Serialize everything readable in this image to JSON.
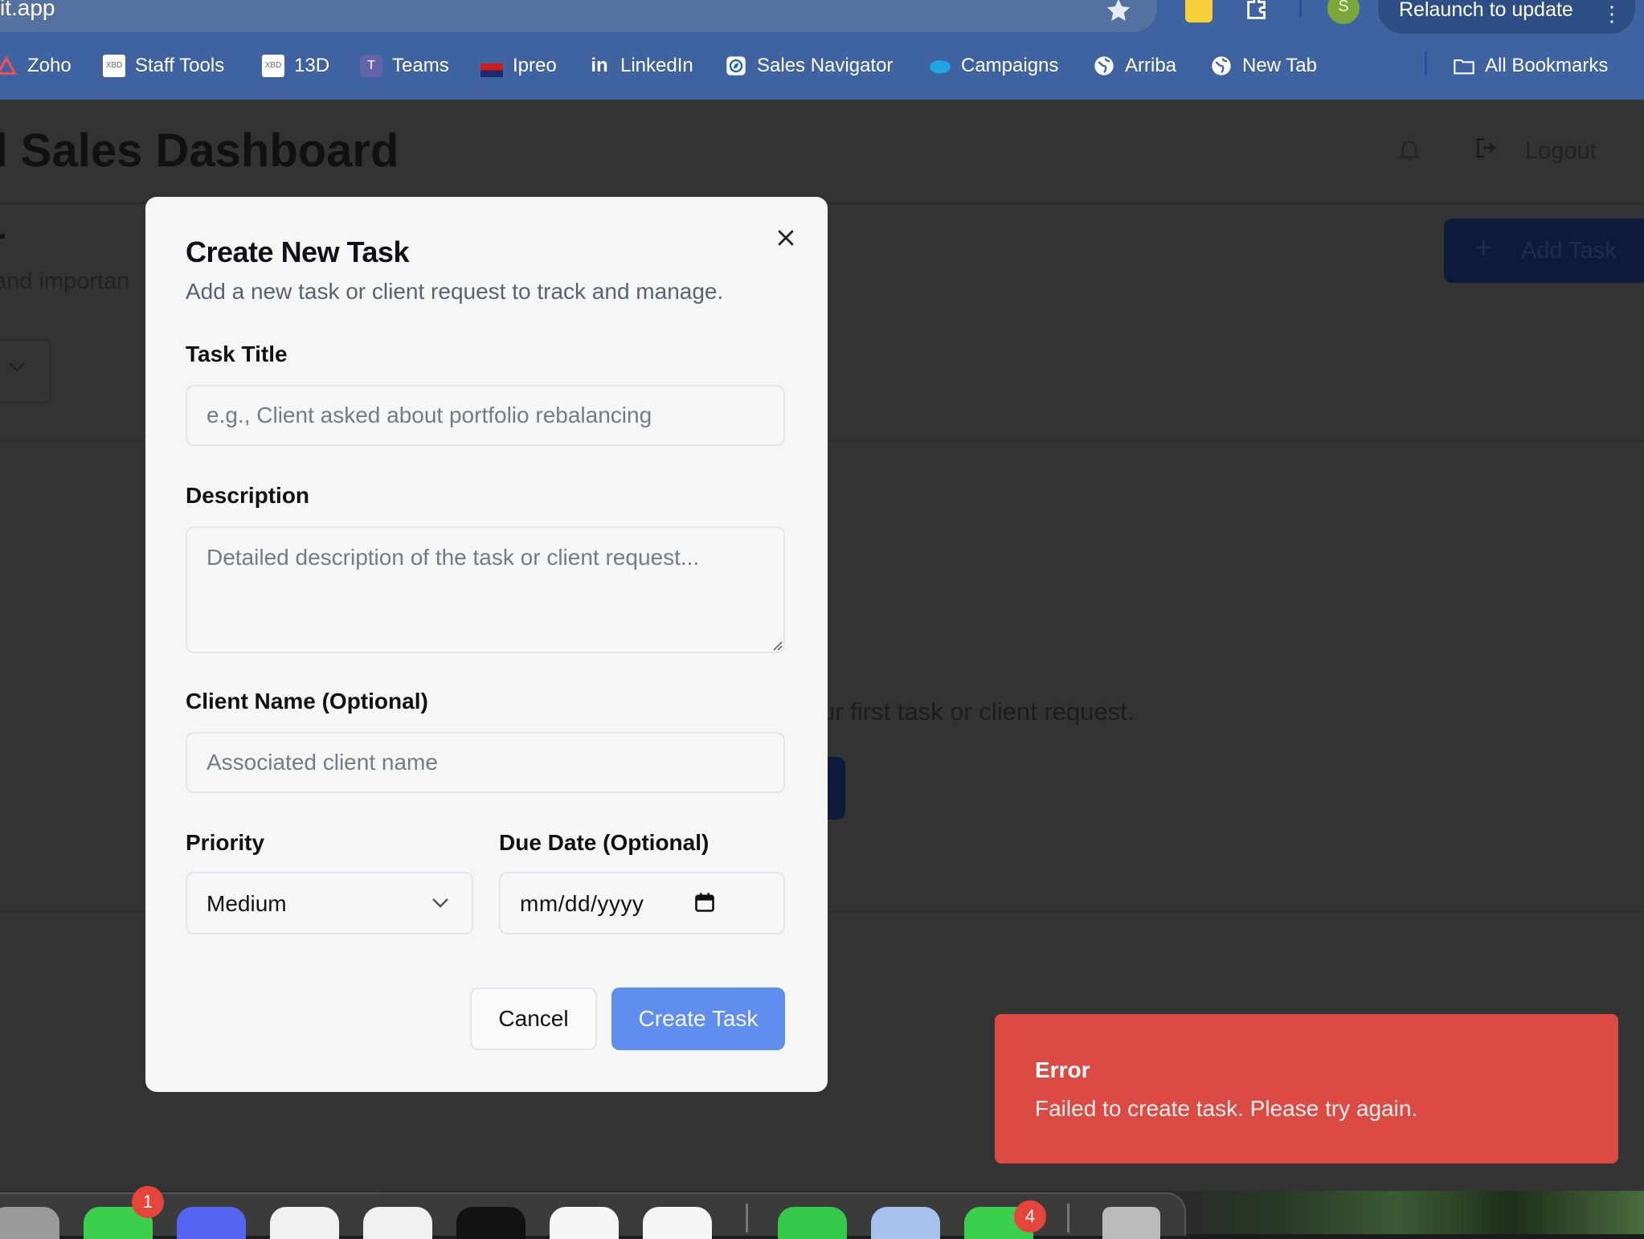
{
  "browser": {
    "url_fragment": "it.app",
    "relaunch_label": "Relaunch to update",
    "profile_initial": "S",
    "bookmarks": [
      {
        "label": "Zoho",
        "icon": "zoho-icon"
      },
      {
        "label": "Staff Tools",
        "icon": "xbrl-icon"
      },
      {
        "label": "13D",
        "icon": "xbrl-icon"
      },
      {
        "label": "Teams",
        "icon": "teams-icon"
      },
      {
        "label": "Ipreo",
        "icon": "ipreo-icon"
      },
      {
        "label": "LinkedIn",
        "icon": "linkedin-icon"
      },
      {
        "label": "Sales Navigator",
        "icon": "compass-icon"
      },
      {
        "label": "Campaigns",
        "icon": "salesforce-cloud-icon"
      },
      {
        "label": "Arriba",
        "icon": "globe-icon"
      },
      {
        "label": "New Tab",
        "icon": "globe-icon"
      }
    ],
    "all_bookmarks_label": "All Bookmarks"
  },
  "app": {
    "title": "ed Sales Dashboard",
    "logout_label": "Logout",
    "section_title": "r",
    "section_subtitle": "and importan",
    "add_task_label": "Add Task",
    "empty_text": "ur first task or client request."
  },
  "modal": {
    "title": "Create New Task",
    "description": "Add a new task or client request to track and manage.",
    "task_title_label": "Task Title",
    "task_title_placeholder": "e.g., Client asked about portfolio rebalancing",
    "description_label": "Description",
    "description_placeholder": "Detailed description of the task or client request...",
    "client_name_label": "Client Name (Optional)",
    "client_name_placeholder": "Associated client name",
    "priority_label": "Priority",
    "priority_value": "Medium",
    "due_date_label": "Due Date (Optional)",
    "due_date_value": "mm/dd/yyyy",
    "cancel_label": "Cancel",
    "create_label": "Create Task"
  },
  "toast": {
    "title": "Error",
    "message": "Failed to create task. Please try again."
  },
  "dock": {
    "messages_badge": "1",
    "whatsapp_badge": "4"
  },
  "colors": {
    "accent": "#5f8eee",
    "error": "#db4b44",
    "chrome": "#3f63a0"
  }
}
